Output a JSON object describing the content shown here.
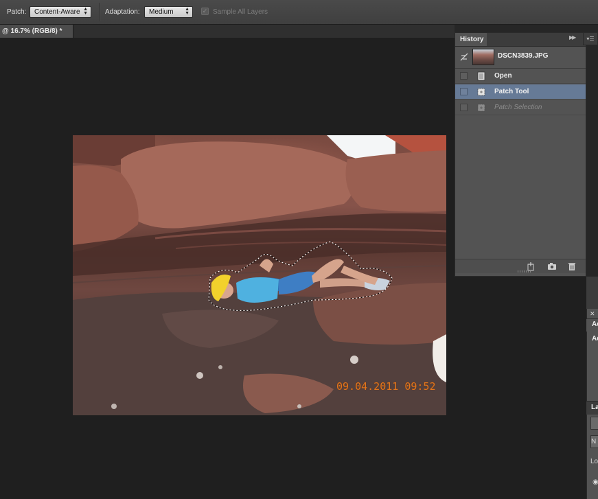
{
  "options_bar": {
    "patch_label": "Patch:",
    "patch_value": "Content-Aware",
    "adaptation_label": "Adaptation:",
    "adaptation_value": "Medium",
    "sample_all_layers_label": "Sample All Layers",
    "sample_all_layers_checked": true
  },
  "document": {
    "tab_title": "@ 16.7% (RGB/8) *",
    "date_stamp": "09.04.2011 09:52"
  },
  "history_panel": {
    "title": "History",
    "snapshot_name": "DSCN3839.JPG",
    "states": [
      {
        "label": "Open",
        "selected": false,
        "dimmed": false
      },
      {
        "label": "Patch Tool",
        "selected": true,
        "dimmed": false
      },
      {
        "label": "Patch Selection",
        "selected": false,
        "dimmed": true
      }
    ],
    "footer_icons": [
      "new-document-from-state-icon",
      "camera-snapshot-icon",
      "trash-icon"
    ]
  },
  "right_panels": {
    "adjustments_tab": "Ad",
    "adjustments_heading": "Ad",
    "layers_tab": "La",
    "layers_kind_row": "N",
    "layers_lock_label": "Lo"
  }
}
